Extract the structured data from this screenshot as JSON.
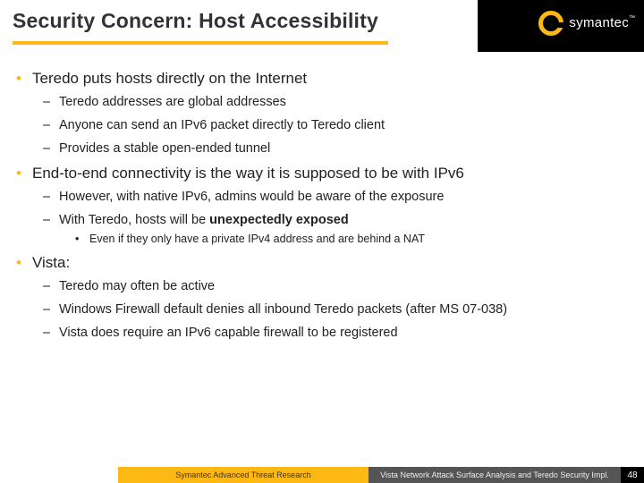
{
  "header": {
    "title": "Security Concern: Host Accessibility",
    "brand": "symantec",
    "tm": "™"
  },
  "body": {
    "b1": {
      "text": "Teredo puts hosts directly on the Internet",
      "s1": "Teredo addresses are global addresses",
      "s2": "Anyone can send an IPv6 packet directly to Teredo client",
      "s3": "Provides a stable open-ended tunnel"
    },
    "b2": {
      "text": "End-to-end connectivity is the way it is supposed to be with IPv6",
      "s1": "However, with native IPv6, admins would be aware of the exposure",
      "s2a": "With Teredo, hosts will be ",
      "s2b": "unexpectedly exposed",
      "s2_sub1": "Even if they only have a private IPv4 address and are behind a NAT"
    },
    "b3": {
      "text": "Vista:",
      "s1": "Teredo may often be active",
      "s2": "Windows Firewall default denies all inbound Teredo packets (after MS 07-038)",
      "s3": "Vista does require an IPv6 capable firewall to be registered"
    }
  },
  "footer": {
    "left": "Symantec Advanced Threat Research",
    "right": "Vista Network Attack Surface Analysis and Teredo Security Impl.",
    "page": "48"
  }
}
